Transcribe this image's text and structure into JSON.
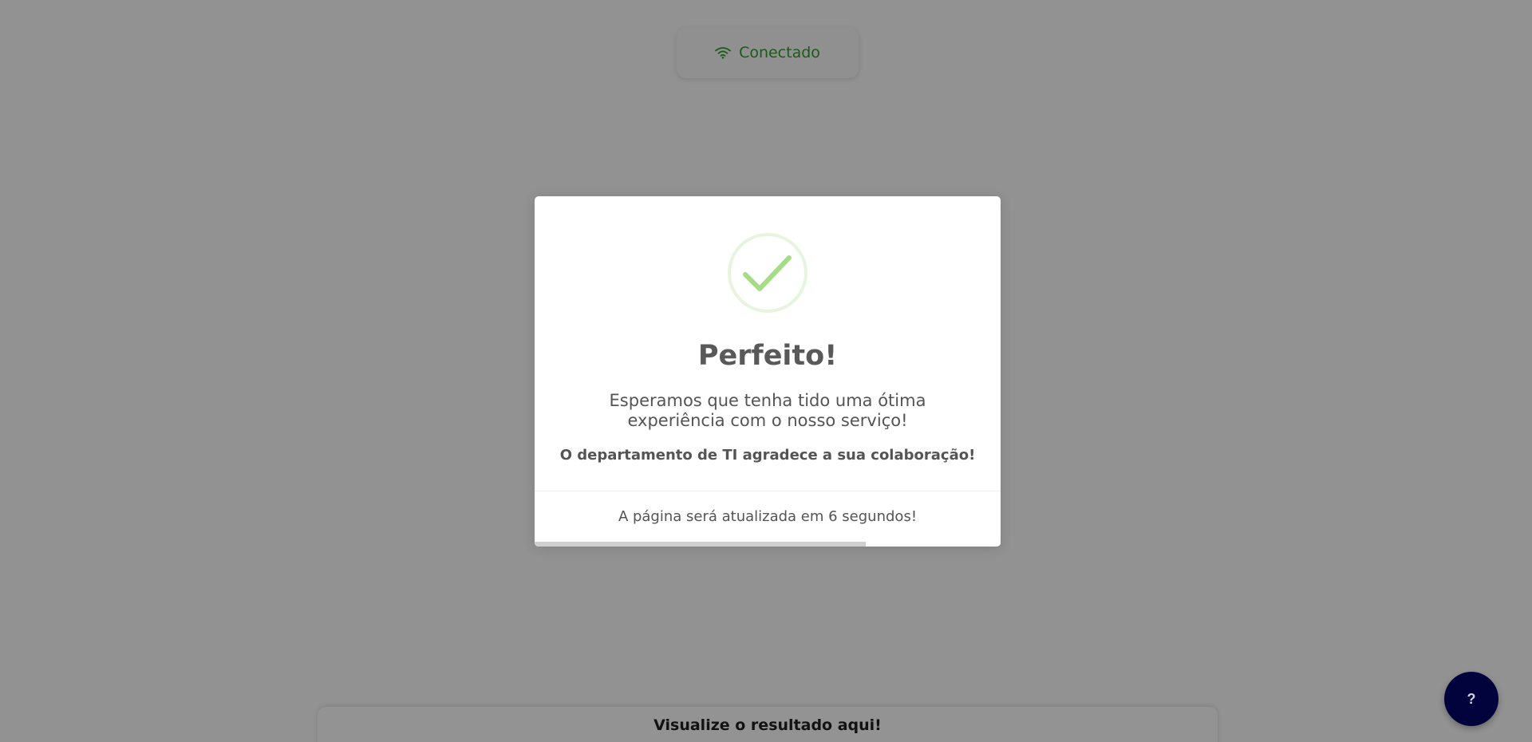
{
  "colors": {
    "overlay": "#929292",
    "connected": "#1c5a1c",
    "success_green": "#a5dc86",
    "help_button": "#02023c"
  },
  "status": {
    "icon": "wifi-icon",
    "label": "Conectado"
  },
  "modal": {
    "icon": "success-check-icon",
    "title": "Perfeito!",
    "text": "Esperamos que tenha tido uma ótima experiência com o nosso serviço!",
    "strong_text": "O departamento de TI agradece a sua colaboração!",
    "footer": "A página será atualizada em 6 segundos!",
    "timer_progress_percent": 71
  },
  "result_card": {
    "title": "Visualize o resultado aqui!"
  },
  "help": {
    "label": "?",
    "icon": "help-icon"
  }
}
